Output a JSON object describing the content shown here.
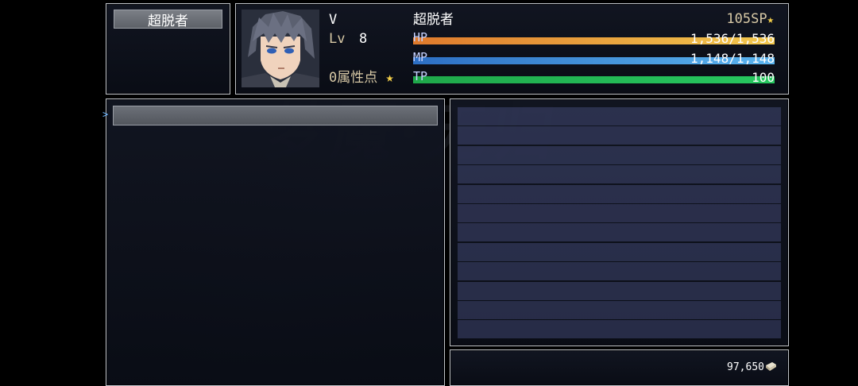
{
  "class_panel": {
    "label": "超脱者"
  },
  "actor": {
    "name": "V",
    "level_label": "Lv",
    "level": "8",
    "class_name": "超脱者",
    "sp": "105SP",
    "attr_points": "0属性点"
  },
  "gauges": {
    "hp": {
      "label": "HP",
      "value": "1,536/1,536",
      "fraction": 1.0,
      "color_from": "#e07a2c",
      "color_to": "#f2c84e"
    },
    "mp": {
      "label": "MP",
      "value": "1,148/1,148",
      "fraction": 1.0,
      "color_from": "#2d6fc4",
      "color_to": "#5ab4ef"
    },
    "tp": {
      "label": "TP",
      "value": "100",
      "fraction": 1.0,
      "color_from": "#1fa84a",
      "color_to": "#27c860"
    }
  },
  "gold": {
    "value": "97,650"
  },
  "icons": {
    "star": "star-icon",
    "sp_stars": "double-star-icon",
    "cursor": "cursor-arrow-icon",
    "gold": "gold-ingot-icon"
  },
  "colors": {
    "system": "#d8c9a6",
    "accent_star": "#f5d04a"
  }
}
